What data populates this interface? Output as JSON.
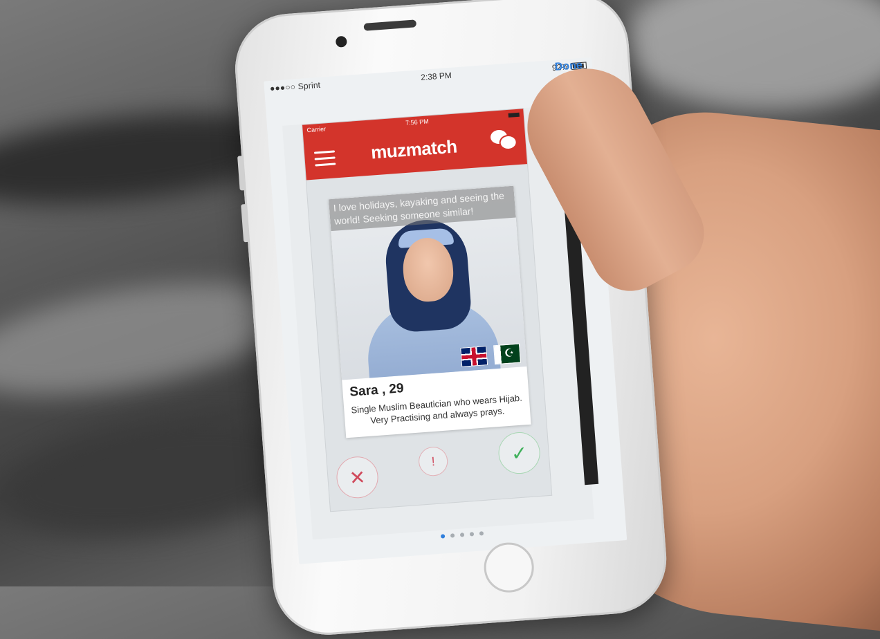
{
  "device_status": {
    "carrier": "●●●○○ Sprint",
    "time": "2:38 PM",
    "battery": "92%"
  },
  "navbar": {
    "done_label": "Done"
  },
  "app": {
    "status": {
      "carrier": "Carrier",
      "time": "7:56 PM"
    },
    "brand": "muzmatch",
    "colors": {
      "brand_red": "#d3342b",
      "link_blue": "#2f7fdc",
      "like_green": "#3eb05a",
      "dislike_red": "#d04a5c"
    },
    "profile": {
      "bio": "I love holidays, kayaking and seeing the world! Seeking someone similar!",
      "name": "Sara , 29",
      "description": "Single Muslim Beautician who wears Hijab. Very Practising and always prays.",
      "flags": [
        "uk-flag",
        "pakistan-flag"
      ]
    },
    "actions": {
      "dislike_symbol": "✕",
      "report_symbol": "!",
      "like_symbol": "✓"
    },
    "page_indicator": {
      "count": 5,
      "active": 0
    }
  }
}
